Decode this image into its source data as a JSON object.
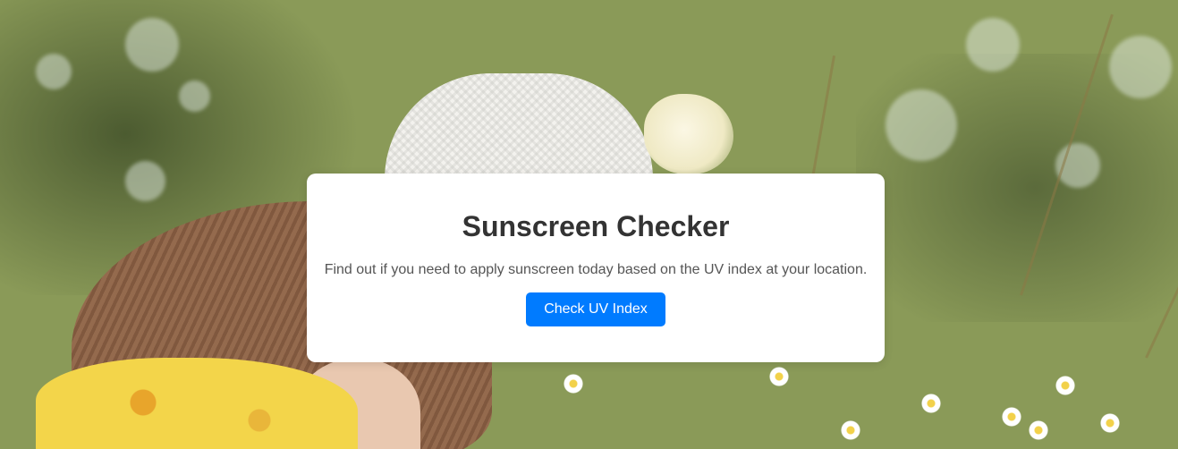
{
  "card": {
    "title": "Sunscreen Checker",
    "description": "Find out if you need to apply sunscreen today based on the UV index at your location.",
    "button_label": "Check UV Index"
  },
  "colors": {
    "button_background": "#007bff",
    "button_text": "#ffffff",
    "title_text": "#333333",
    "description_text": "#555555",
    "card_background": "#ffffff"
  },
  "background": {
    "icon": "sunny-meadow-photo-background"
  }
}
